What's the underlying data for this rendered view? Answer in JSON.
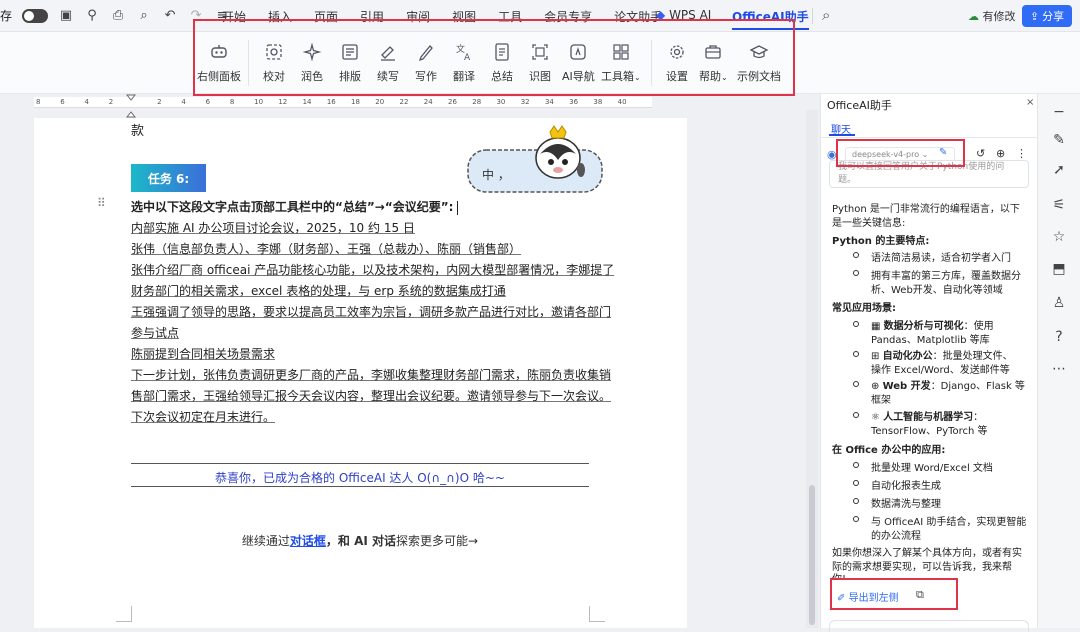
{
  "menubar": {
    "partial_left": "存",
    "tabs": [
      "开始",
      "插入",
      "页面",
      "引用",
      "审阅",
      "视图",
      "工具",
      "会员专享",
      "论文助手"
    ],
    "wps_ai": "WPS AI",
    "officeai_tab": "OfficeAI助手",
    "modify": "有修改",
    "share": "分享"
  },
  "ribbon": {
    "items": [
      {
        "label": "右侧面板",
        "icon": "robot-icon"
      },
      {
        "label": "校对",
        "icon": "proofread-icon"
      },
      {
        "label": "润色",
        "icon": "sparkle-icon"
      },
      {
        "label": "排版",
        "icon": "layout-icon"
      },
      {
        "label": "续写",
        "icon": "continue-write-icon"
      },
      {
        "label": "写作",
        "icon": "pen-icon"
      },
      {
        "label": "翻译",
        "icon": "translate-icon"
      },
      {
        "label": "总结",
        "icon": "summary-icon"
      },
      {
        "label": "识图",
        "icon": "image-recognize-icon"
      },
      {
        "label": "AI导航",
        "icon": "ai-nav-icon"
      },
      {
        "label": "工具箱",
        "icon": "toolbox-icon",
        "dropdown": true
      },
      {
        "label": "设置",
        "icon": "settings-icon"
      },
      {
        "label": "帮助",
        "icon": "help-icon",
        "dropdown": true
      },
      {
        "label": "示例文档",
        "icon": "graduation-cap-icon"
      }
    ]
  },
  "ruler": {
    "ticks": [
      "8",
      "6",
      "4",
      "2",
      "",
      "2",
      "4",
      "6",
      "8",
      "10",
      "12",
      "14",
      "16",
      "18",
      "20",
      "22",
      "24",
      "26",
      "28",
      "30",
      "32",
      "34",
      "36",
      "38",
      "40"
    ]
  },
  "doc": {
    "top_fragment": "款",
    "sticker_text": "中 ，",
    "task_badge": "任务 6:",
    "instruction": "选中以下这段文字点击顶部工具栏中的“总结”→“会议纪要”:",
    "lines": [
      "内部实施 AI 办公项目讨论会议，2025，10 约 15 日",
      "张伟（信息部负责人）、李娜（财务部）、王强（总裁办）、陈丽（销售部）",
      "张伟介绍厂商 officeai 产品功能核心功能，以及技术架构，内网大模型部署情况，李娜提了",
      "财务部门的相关需求，excel 表格的处理，与 erp 系统的数据集成打通",
      "王强强调了领导的思路，要求以提高员工效率为宗旨，调研多款产品进行对比，邀请各部门",
      "参与试点",
      "陈丽提到合同相关场景需求",
      "下一步计划，张伟负责调研更多厂商的产品，李娜收集整理财务部门需求，陈丽负责收集销",
      "售部门需求，王强给领导汇报今天会议内容，整理出会议纪要。邀请领导参与下一次会议。",
      "下次会议初定在月末进行。"
    ],
    "congrats": "恭喜你，已成为合格的 OfficeAI 达人 O(∩_∩)O 哈~~",
    "continue_prefix": "继续通过",
    "continue_link": "对话框",
    "continue_mid": "，和 AI 对话",
    "continue_suffix": "探索更多可能→"
  },
  "panel": {
    "title": "OfficeAI助手",
    "tab_chat": "聊天",
    "model": "deepseek-v4-pro",
    "prompt_excerpt_1": "我可以直接回答用户关于Python使用的问",
    "prompt_excerpt_2": "题。",
    "answer": {
      "intro_1": "Python 是一门非常流行的编程语言，以下",
      "intro_2": "是一些关键信息:",
      "features_title": "Python 的主要特点:",
      "features": [
        [
          "语法简洁易读，适合初学者入门"
        ],
        [
          "拥有丰富的第三方库，覆盖数据分",
          "析、Web开发、自动化等领域"
        ]
      ],
      "scenes_title": "常见应用场景:",
      "scenes": [
        {
          "head": "数据分析与可视化",
          "rest": "：使用",
          "line2": "Pandas、Matplotlib 等库",
          "icon": "chart-icon"
        },
        {
          "head": "自动化办公",
          "rest": "：批量处理文件、",
          "line2": "操作 Excel/Word、发送邮件等",
          "icon": "robot-icon"
        },
        {
          "head": "Web 开发",
          "rest": "：Django、Flask 等",
          "line2": "框架",
          "icon": "globe-icon"
        },
        {
          "head": "人工智能与机器学习",
          "rest": "：",
          "line2": "TensorFlow、PyTorch 等",
          "icon": "ai-icon"
        }
      ],
      "office_title": "在 Office 办公中的应用:",
      "office": [
        [
          "批量处理 Word/Excel 文档"
        ],
        [
          "自动化报表生成"
        ],
        [
          "数据清洗与整理"
        ],
        [
          "与 OfficeAI 助手结合，实现更智能",
          "的办公流程"
        ]
      ],
      "outro_1": "如果你想深入了解某个具体方向，或者有实",
      "outro_2": "际的需求想要实现，可以告诉我，我来帮",
      "outro_3": "你!"
    },
    "export_label": "导出到左侧"
  }
}
